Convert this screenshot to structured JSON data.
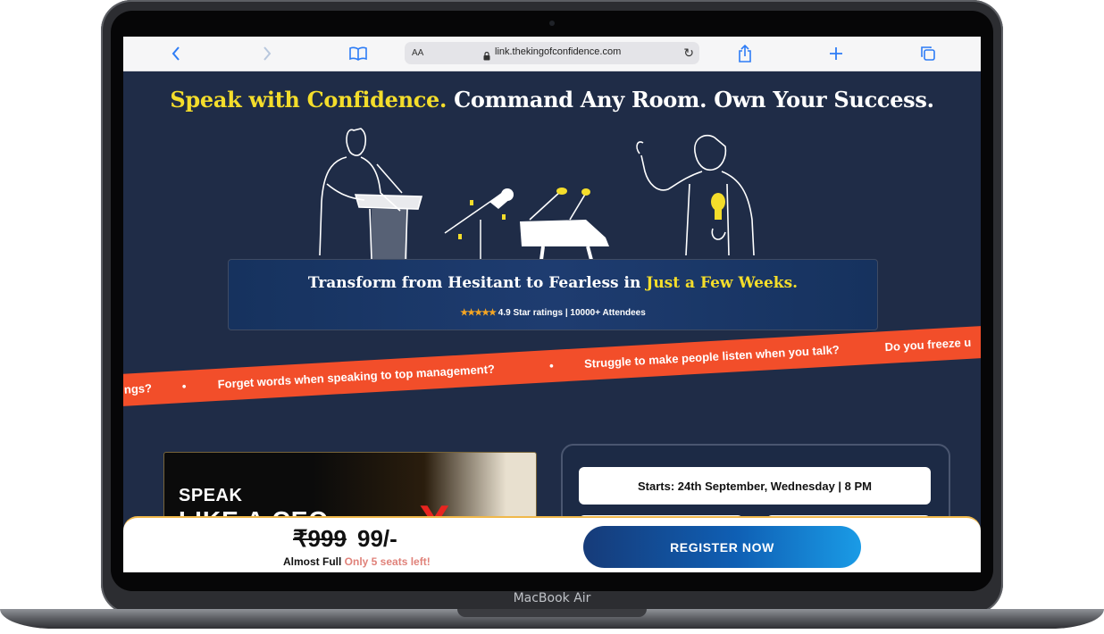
{
  "device": {
    "label": "MacBook Air"
  },
  "browser": {
    "aa_label": "AA",
    "url": "link.thekingofconfidence.com",
    "icons": [
      "back-icon",
      "forward-icon",
      "bookmarks-icon",
      "lock-icon",
      "reload-icon",
      "share-icon",
      "new-tab-icon",
      "tabs-icon"
    ],
    "accent": "#2d7cf6"
  },
  "hero": {
    "headline_highlight": "Speak with Confidence.",
    "headline_rest": " Command Any Room. Own Your Success.",
    "promo_title": "Transform from Hesitant to Fearless in ",
    "promo_title_highlight": "Just a Few Weeks.",
    "stars": "★★★★★",
    "ratings": " 4.9 Star ratings | 10000+ Attendees"
  },
  "ticker": {
    "items": [
      "ngs?",
      "•",
      "Forget words when speaking to top management?",
      "•",
      "Struggle to make people listen when you talk?",
      "Do you freeze u"
    ],
    "color": "#f24e2a"
  },
  "video": {
    "line1": "SPEAK",
    "line2": "LIKE A CEO",
    "mark": "X"
  },
  "event": {
    "starts": "Starts: 24th September, Wednesday | 8 PM"
  },
  "cta": {
    "old_price": "₹999",
    "new_price": "99/-",
    "almost_full": "Almost Full ",
    "seats_left": "Only 5 seats left!",
    "register_label": "REGISTER NOW"
  },
  "colors": {
    "highlight": "#f4dd2b",
    "page_bg": "#1f2c47",
    "button": "#0f5fb4"
  }
}
